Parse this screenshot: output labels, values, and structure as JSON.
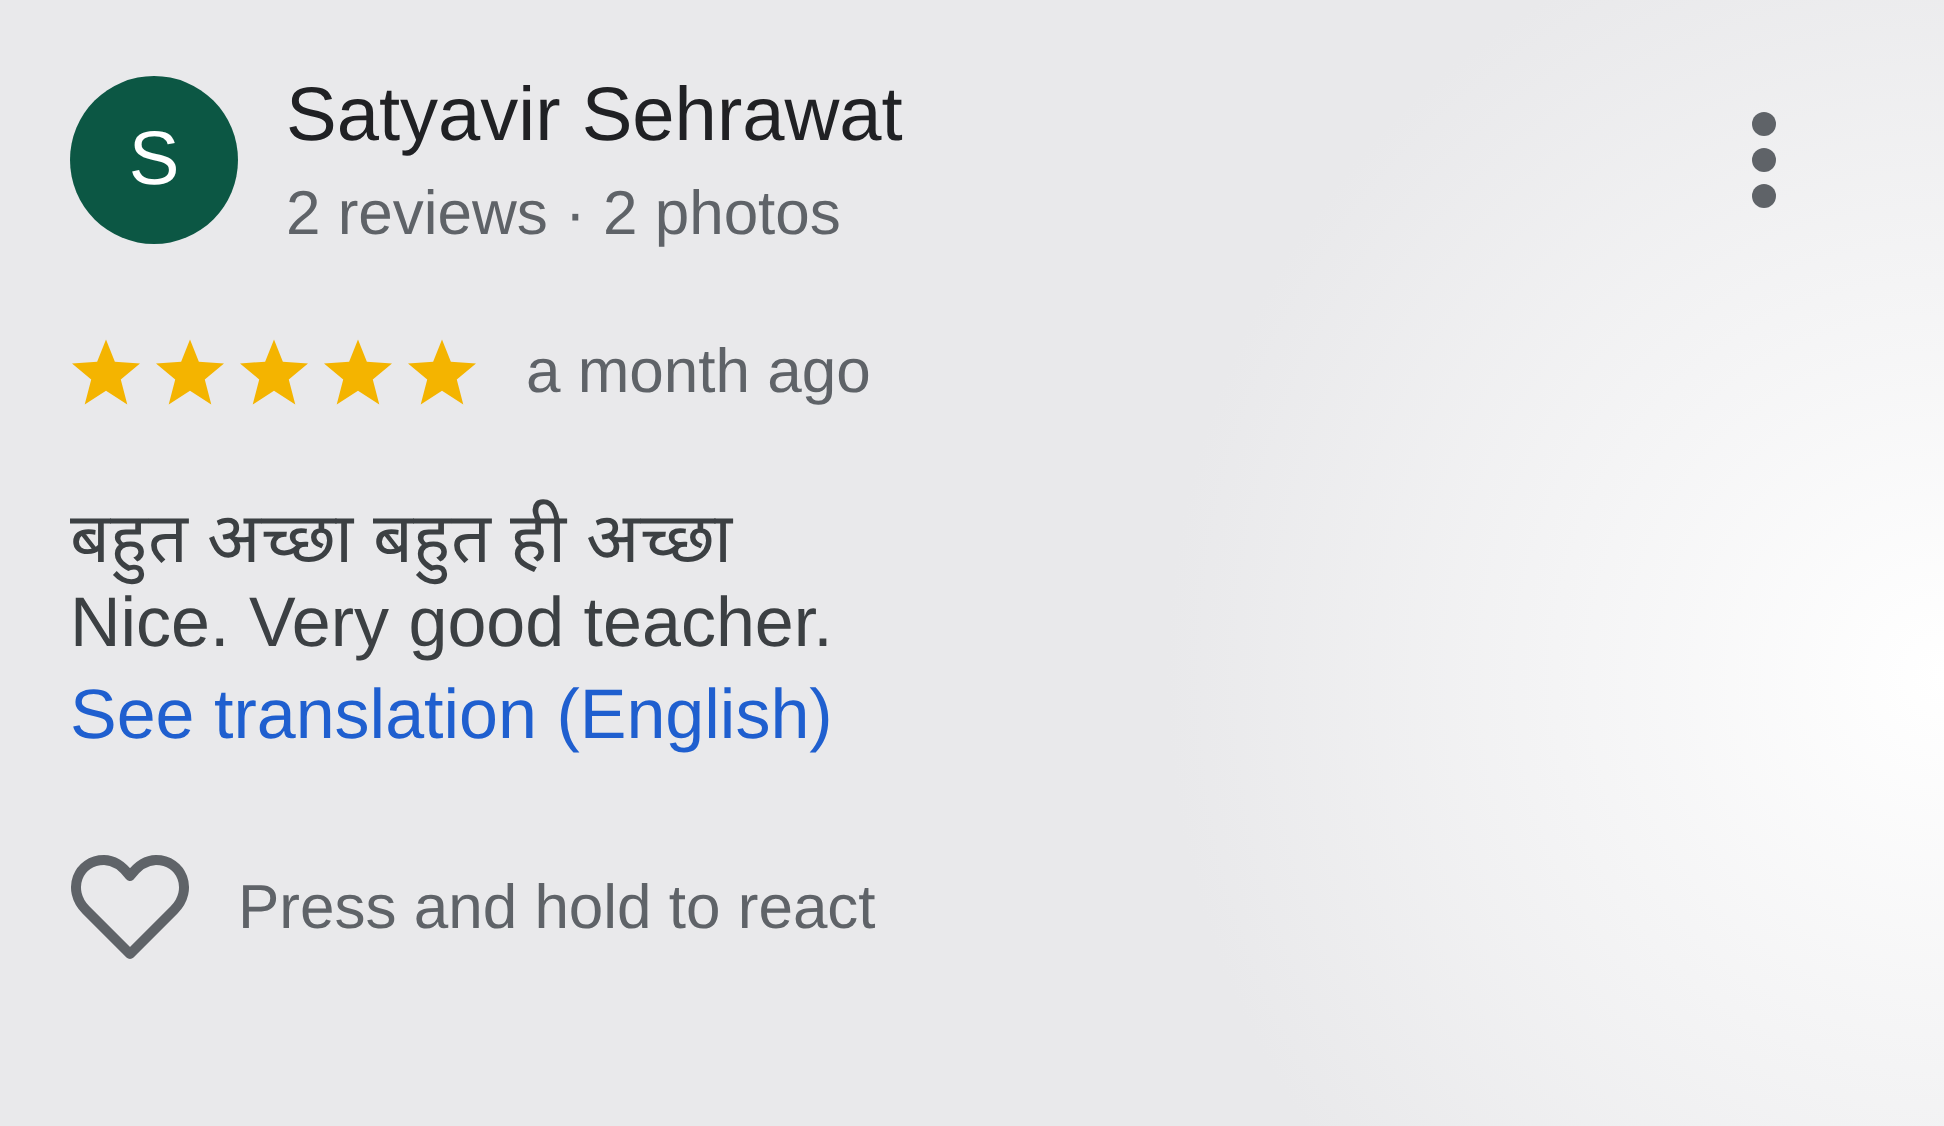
{
  "reviewer": {
    "initial": "S",
    "name": "Satyavir Sehrawat",
    "stats": "2 reviews · 2 photos"
  },
  "rating": {
    "stars": 5
  },
  "time": "a month ago",
  "review_text": [
    "बहुत अच्छा बहुत ही अच्छा",
    "Nice. Very good teacher."
  ],
  "translation_link": "See translation (English)",
  "reaction": {
    "liked": false,
    "label": "Press and hold to react"
  }
}
